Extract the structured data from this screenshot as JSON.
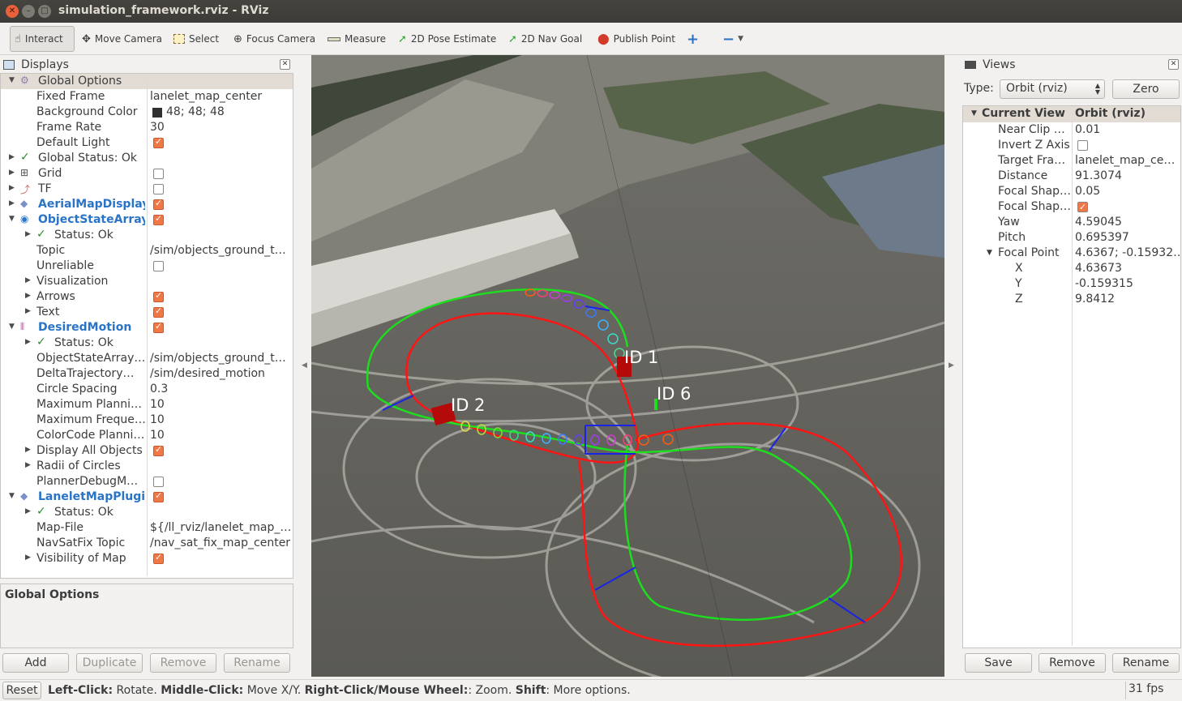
{
  "window": {
    "title": "simulation_framework.rviz - RViz"
  },
  "toolbar": {
    "interact": "Interact",
    "move_camera": "Move Camera",
    "select": "Select",
    "focus_camera": "Focus Camera",
    "measure": "Measure",
    "pose_estimate": "2D Pose Estimate",
    "nav_goal": "2D Nav Goal",
    "publish_point": "Publish Point"
  },
  "displays": {
    "title": "Displays",
    "rows": [
      {
        "name": "Global Options",
        "value": ""
      },
      {
        "name": "Fixed Frame",
        "value": "lanelet_map_center"
      },
      {
        "name": "Background Color",
        "value": "48; 48; 48"
      },
      {
        "name": "Frame Rate",
        "value": "30"
      },
      {
        "name": "Default Light",
        "value": ""
      },
      {
        "name": "Global Status: Ok",
        "value": ""
      },
      {
        "name": "Grid",
        "value": ""
      },
      {
        "name": "TF",
        "value": ""
      },
      {
        "name": "AerialMapDisplay",
        "value": ""
      },
      {
        "name": "ObjectStateArray",
        "value": ""
      },
      {
        "name": "Status: Ok",
        "value": ""
      },
      {
        "name": "Topic",
        "value": "/sim/objects_ground_t…"
      },
      {
        "name": "Unreliable",
        "value": ""
      },
      {
        "name": "Visualization",
        "value": ""
      },
      {
        "name": "Arrows",
        "value": ""
      },
      {
        "name": "Text",
        "value": ""
      },
      {
        "name": "DesiredMotion",
        "value": ""
      },
      {
        "name": "Status: Ok",
        "value": ""
      },
      {
        "name": "ObjectStateArray…",
        "value": "/sim/objects_ground_t…"
      },
      {
        "name": "DeltaTrajectory…",
        "value": "/sim/desired_motion"
      },
      {
        "name": "Circle Spacing",
        "value": "0.3"
      },
      {
        "name": "Maximum Planni…",
        "value": "10"
      },
      {
        "name": "Maximum Freque…",
        "value": "10"
      },
      {
        "name": "ColorCode Planni…",
        "value": "10"
      },
      {
        "name": "Display All Objects",
        "value": ""
      },
      {
        "name": "Radii of Circles",
        "value": ""
      },
      {
        "name": "PlannerDebugM…",
        "value": ""
      },
      {
        "name": "LaneletMapPlugin",
        "value": ""
      },
      {
        "name": "Status: Ok",
        "value": ""
      },
      {
        "name": "Map-File",
        "value": "${/ll_rviz/lanelet_map_…"
      },
      {
        "name": "NavSatFix Topic",
        "value": "/nav_sat_fix_map_center"
      },
      {
        "name": "Visibility of Map",
        "value": ""
      }
    ],
    "description_title": "Global Options",
    "add": "Add",
    "duplicate": "Duplicate",
    "remove": "Remove",
    "rename": "Rename"
  },
  "views": {
    "title": "Views",
    "type_label": "Type:",
    "type_value": "Orbit (rviz)",
    "zero": "Zero",
    "header_name": "Current View",
    "header_value": "Orbit (rviz)",
    "rows": [
      {
        "name": "Near Clip …",
        "value": "0.01"
      },
      {
        "name": "Invert Z Axis",
        "value": ""
      },
      {
        "name": "Target Fra…",
        "value": "lanelet_map_ce…"
      },
      {
        "name": "Distance",
        "value": "91.3074"
      },
      {
        "name": "Focal Shap…",
        "value": "0.05"
      },
      {
        "name": "Focal Shap…",
        "value": ""
      },
      {
        "name": "Yaw",
        "value": "4.59045"
      },
      {
        "name": "Pitch",
        "value": "0.695397"
      },
      {
        "name": "Focal Point",
        "value": "4.6367; -0.15932…"
      },
      {
        "name": "X",
        "value": "4.63673"
      },
      {
        "name": "Y",
        "value": "-0.159315"
      },
      {
        "name": "Z",
        "value": "9.8412"
      }
    ],
    "save": "Save",
    "remove": "Remove",
    "rename": "Rename"
  },
  "viewport": {
    "labels": [
      "ID 1",
      "ID 6",
      "ID 2"
    ]
  },
  "status": {
    "reset": "Reset",
    "left_click_key": "Left-Click:",
    "left_click_text": " Rotate. ",
    "middle_click_key": "Middle-Click:",
    "middle_click_text": " Move X/Y. ",
    "right_click_key": "Right-Click/Mouse Wheel:",
    "right_click_text": ": Zoom. ",
    "shift_key": "Shift",
    "shift_text": ": More options.",
    "fps": "31 fps"
  }
}
